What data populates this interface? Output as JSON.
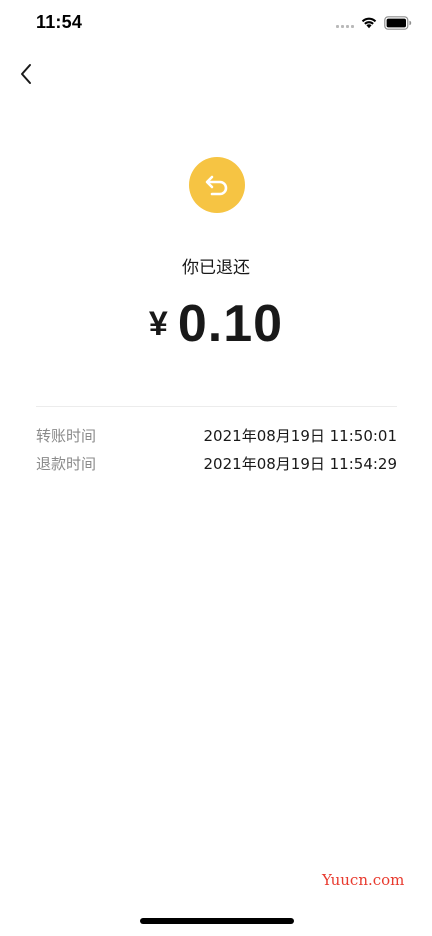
{
  "status_bar": {
    "time": "11:54",
    "signal_icon": "signal-icon",
    "wifi_icon": "wifi-icon",
    "battery_icon": "battery-icon"
  },
  "nav": {
    "back_icon": "chevron-left-icon"
  },
  "refund": {
    "icon": "return-arrow-icon",
    "icon_bg_color": "#f6c443",
    "status_text": "你已退还",
    "currency_symbol": "¥",
    "amount": "0.10"
  },
  "details": [
    {
      "label": "转账时间",
      "value": "2021年08月19日 11:50:01"
    },
    {
      "label": "退款时间",
      "value": "2021年08月19日 11:54:29"
    }
  ],
  "watermark": "Yuucn.com",
  "colors": {
    "accent": "#f6c443",
    "watermark": "#e83a2e",
    "label": "#8a8a8a",
    "text": "#191919"
  }
}
